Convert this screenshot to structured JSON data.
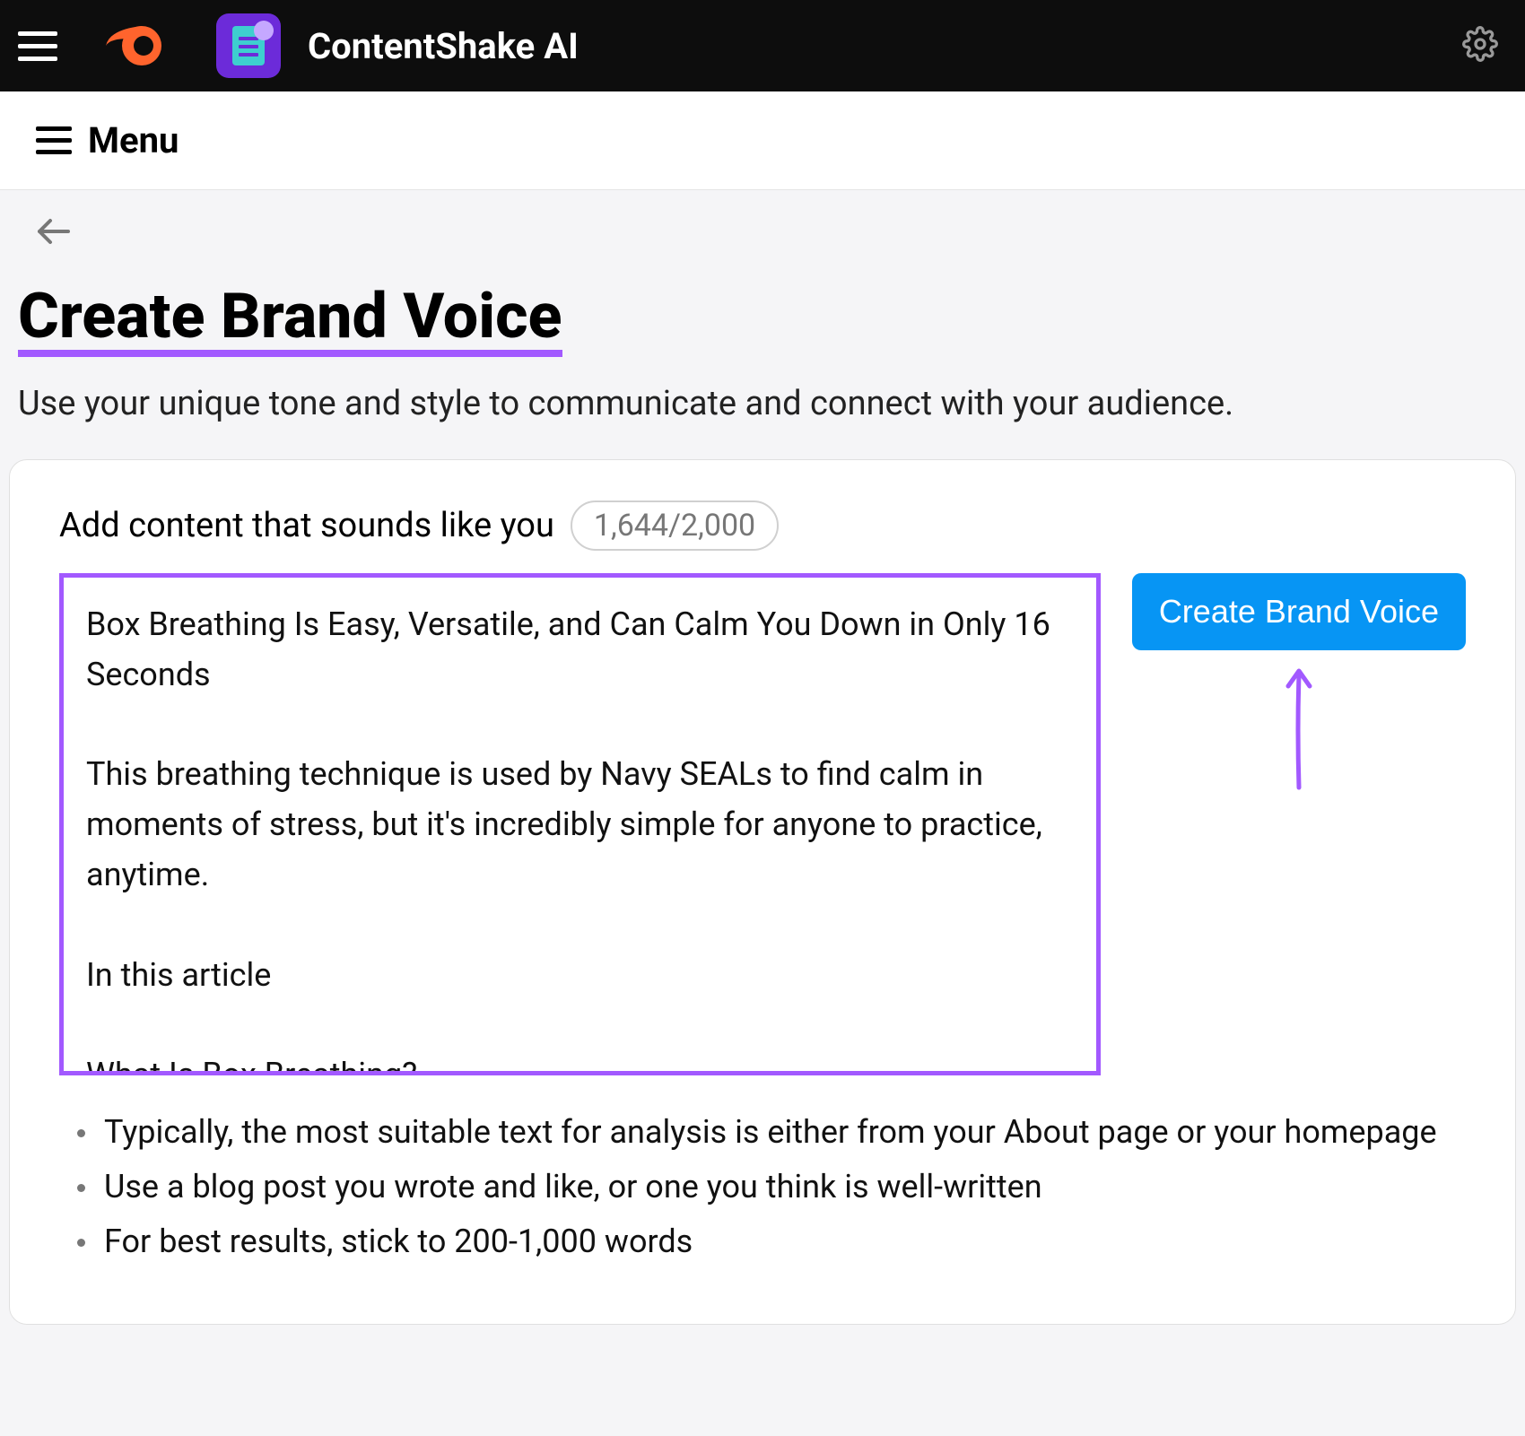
{
  "header": {
    "app_title": "ContentShake AI"
  },
  "menubar": {
    "label": "Menu"
  },
  "page": {
    "title": "Create Brand Voice",
    "subtitle": "Use your unique tone and style to communicate and connect with your audience."
  },
  "card": {
    "add_content_label": "Add content that sounds like you",
    "counter": "1,644/2,000",
    "textarea_value": "Box Breathing Is Easy, Versatile, and Can Calm You Down in Only 16 Seconds\n\nThis breathing technique is used by Navy SEALs to find calm in moments of stress, but it's incredibly simple for anyone to practice, anytime.\n\nIn this article\n\nWhat Is Box Breathing?",
    "create_button_label": "Create Brand Voice",
    "tips": [
      "Typically, the most suitable text for analysis is either from your About page or your homepage",
      "Use a blog post you wrote and like, or one you think is well-written",
      "For best results, stick to 200-1,000 words"
    ]
  },
  "colors": {
    "accent_purple": "#A259FF",
    "button_blue": "#0795F4",
    "brand_orange": "#FF642D"
  }
}
